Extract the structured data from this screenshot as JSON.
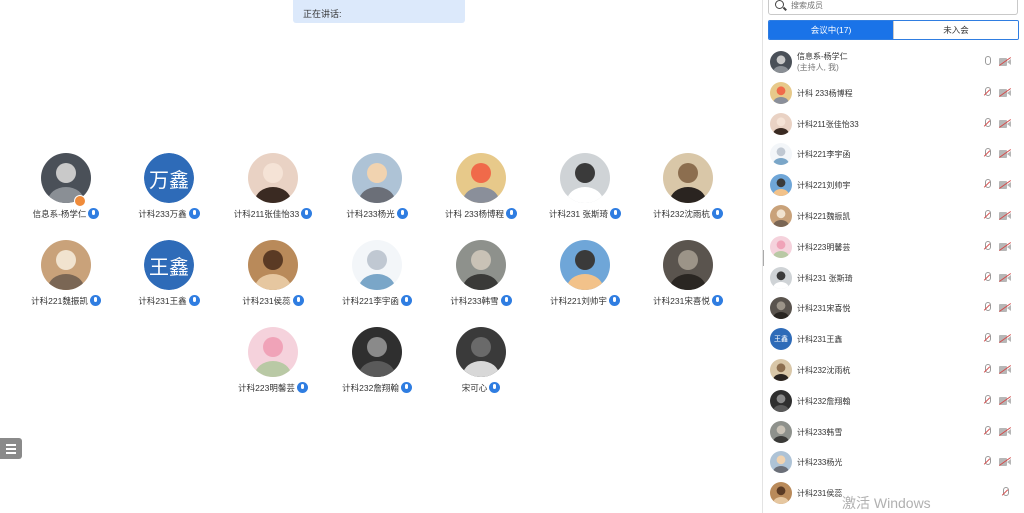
{
  "speaking_label": "正在讲话:",
  "colors": {
    "accent": "#1a73e8",
    "mic_blue": "#2f7de1",
    "host_badge": "#f08b3a",
    "text_avatar": "#2e6bb8",
    "speaking_bg": "#dce9fb"
  },
  "grid": [
    {
      "name": "信息系-杨学仁",
      "avatar_text": "",
      "host": true
    },
    {
      "name": "计科233万鑫",
      "avatar_text": "万鑫",
      "host": false
    },
    {
      "name": "计科211张佳怡33",
      "avatar_text": "",
      "host": false
    },
    {
      "name": "计科233杨光",
      "avatar_text": "",
      "host": false
    },
    {
      "name": "计科 233杨博程",
      "avatar_text": "",
      "host": false
    },
    {
      "name": "计科231 张斯琦",
      "avatar_text": "",
      "host": false
    },
    {
      "name": "计科232沈雨杭",
      "avatar_text": "",
      "host": false
    },
    {
      "name": "计科221魏振凯",
      "avatar_text": "",
      "host": false
    },
    {
      "name": "计科231王鑫",
      "avatar_text": "王鑫",
      "host": false
    },
    {
      "name": "计科231侯蕊",
      "avatar_text": "",
      "host": false
    },
    {
      "name": "计科221李宇函",
      "avatar_text": "",
      "host": false
    },
    {
      "name": "计科233韩雪",
      "avatar_text": "",
      "host": false
    },
    {
      "name": "计科221刘帅宇",
      "avatar_text": "",
      "host": false
    },
    {
      "name": "计科231宋喜悦",
      "avatar_text": "",
      "host": false
    },
    {
      "name": "计科223明馨芸",
      "avatar_text": "",
      "host": false
    },
    {
      "name": "计科232詹翔翰",
      "avatar_text": "",
      "host": false
    },
    {
      "name": "宋可心",
      "avatar_text": "",
      "host": false
    }
  ],
  "sidebar": {
    "search_placeholder": "搜索成员",
    "tab_in_meeting": "会议中(17)",
    "tab_not_joined": "未入会",
    "members": [
      {
        "name": "信息系-杨学仁",
        "sub": "(主持人, 我)",
        "avatar_text": "",
        "mic_on": true,
        "cam_icon": true
      },
      {
        "name": "计科 233杨博程",
        "sub": "",
        "avatar_text": "",
        "mic_on": false,
        "cam_icon": true
      },
      {
        "name": "计科211张佳怡33",
        "sub": "",
        "avatar_text": "",
        "mic_on": false,
        "cam_icon": true
      },
      {
        "name": "计科221李宇函",
        "sub": "",
        "avatar_text": "",
        "mic_on": false,
        "cam_icon": true
      },
      {
        "name": "计科221刘帅宇",
        "sub": "",
        "avatar_text": "",
        "mic_on": false,
        "cam_icon": true
      },
      {
        "name": "计科221魏振凯",
        "sub": "",
        "avatar_text": "",
        "mic_on": false,
        "cam_icon": true
      },
      {
        "name": "计科223明馨芸",
        "sub": "",
        "avatar_text": "",
        "mic_on": false,
        "cam_icon": true
      },
      {
        "name": "计科231 张斯琦",
        "sub": "",
        "avatar_text": "",
        "mic_on": false,
        "cam_icon": true
      },
      {
        "name": "计科231宋喜悦",
        "sub": "",
        "avatar_text": "",
        "mic_on": false,
        "cam_icon": true
      },
      {
        "name": "计科231王鑫",
        "sub": "",
        "avatar_text": "王鑫",
        "mic_on": false,
        "cam_icon": true
      },
      {
        "name": "计科232沈雨杭",
        "sub": "",
        "avatar_text": "",
        "mic_on": false,
        "cam_icon": true
      },
      {
        "name": "计科232詹翔翰",
        "sub": "",
        "avatar_text": "",
        "mic_on": false,
        "cam_icon": true
      },
      {
        "name": "计科233韩雪",
        "sub": "",
        "avatar_text": "",
        "mic_on": false,
        "cam_icon": true
      },
      {
        "name": "计科233杨光",
        "sub": "",
        "avatar_text": "",
        "mic_on": false,
        "cam_icon": true
      },
      {
        "name": "计科231侯蕊",
        "sub": "",
        "avatar_text": "",
        "mic_on": false,
        "cam_icon": false
      }
    ]
  },
  "watermark": "激活 Windows"
}
